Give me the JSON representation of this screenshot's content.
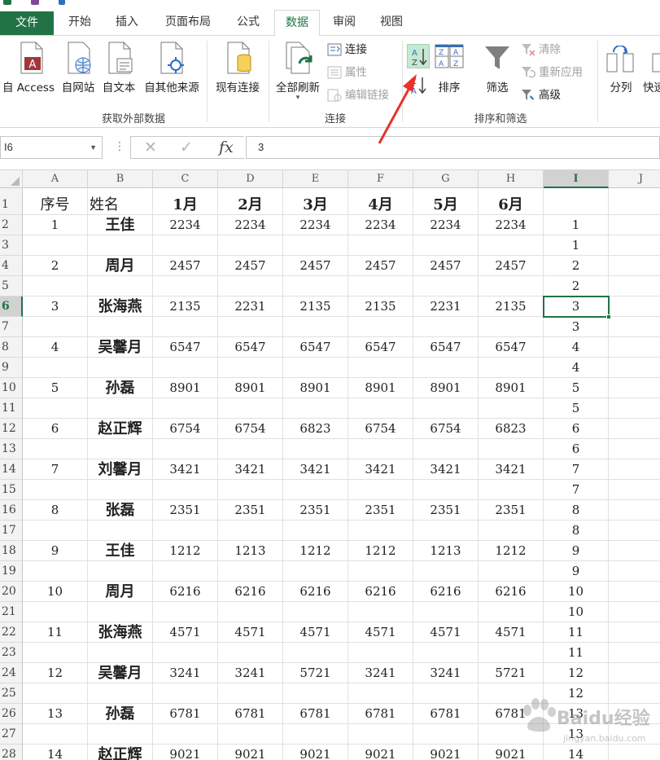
{
  "ribbon_tabs": [
    "文件",
    "开始",
    "插入",
    "页面布局",
    "公式",
    "数据",
    "审阅",
    "视图"
  ],
  "active_tab": "数据",
  "groups": {
    "external": {
      "label": "获取外部数据",
      "buttons": [
        "自 Access",
        "自网站",
        "自文本",
        "自其他来源",
        "现有连接"
      ]
    },
    "connections": {
      "label": "连接",
      "refresh_all": "全部刷新",
      "items": [
        "连接",
        "属性",
        "编辑链接"
      ]
    },
    "sort_filter": {
      "label": "排序和筛选",
      "sort": "排序",
      "filter": "筛选",
      "items": [
        "清除",
        "重新应用",
        "高级"
      ]
    },
    "tools": {
      "split": "分列",
      "quick": "快速"
    }
  },
  "formula_bar": {
    "name_box": "I6",
    "formula": "3",
    "fx": "fx"
  },
  "columns": [
    "A",
    "B",
    "C",
    "D",
    "E",
    "F",
    "G",
    "H",
    "I",
    "J"
  ],
  "selected_column": "I",
  "selected_row": 6,
  "rows": [
    {
      "n": 1,
      "A": "序号",
      "B": "姓名",
      "C": "1月",
      "D": "2月",
      "E": "3月",
      "F": "4月",
      "G": "5月",
      "H": "6月",
      "I": ""
    },
    {
      "n": 2,
      "A": "1",
      "B": "王佳",
      "C": "2234",
      "D": "2234",
      "E": "2234",
      "F": "2234",
      "G": "2234",
      "H": "2234",
      "I": "1"
    },
    {
      "n": 3,
      "A": "",
      "B": "",
      "C": "",
      "D": "",
      "E": "",
      "F": "",
      "G": "",
      "H": "",
      "I": "1"
    },
    {
      "n": 4,
      "A": "2",
      "B": "周月",
      "C": "2457",
      "D": "2457",
      "E": "2457",
      "F": "2457",
      "G": "2457",
      "H": "2457",
      "I": "2"
    },
    {
      "n": 5,
      "A": "",
      "B": "",
      "C": "",
      "D": "",
      "E": "",
      "F": "",
      "G": "",
      "H": "",
      "I": "2"
    },
    {
      "n": 6,
      "A": "3",
      "B": "张海燕",
      "C": "2135",
      "D": "2231",
      "E": "2135",
      "F": "2135",
      "G": "2231",
      "H": "2135",
      "I": "3"
    },
    {
      "n": 7,
      "A": "",
      "B": "",
      "C": "",
      "D": "",
      "E": "",
      "F": "",
      "G": "",
      "H": "",
      "I": "3"
    },
    {
      "n": 8,
      "A": "4",
      "B": "吴馨月",
      "C": "6547",
      "D": "6547",
      "E": "6547",
      "F": "6547",
      "G": "6547",
      "H": "6547",
      "I": "4"
    },
    {
      "n": 9,
      "A": "",
      "B": "",
      "C": "",
      "D": "",
      "E": "",
      "F": "",
      "G": "",
      "H": "",
      "I": "4"
    },
    {
      "n": 10,
      "A": "5",
      "B": "孙磊",
      "C": "8901",
      "D": "8901",
      "E": "8901",
      "F": "8901",
      "G": "8901",
      "H": "8901",
      "I": "5"
    },
    {
      "n": 11,
      "A": "",
      "B": "",
      "C": "",
      "D": "",
      "E": "",
      "F": "",
      "G": "",
      "H": "",
      "I": "5"
    },
    {
      "n": 12,
      "A": "6",
      "B": "赵正辉",
      "C": "6754",
      "D": "6754",
      "E": "6823",
      "F": "6754",
      "G": "6754",
      "H": "6823",
      "I": "6"
    },
    {
      "n": 13,
      "A": "",
      "B": "",
      "C": "",
      "D": "",
      "E": "",
      "F": "",
      "G": "",
      "H": "",
      "I": "6"
    },
    {
      "n": 14,
      "A": "7",
      "B": "刘馨月",
      "C": "3421",
      "D": "3421",
      "E": "3421",
      "F": "3421",
      "G": "3421",
      "H": "3421",
      "I": "7"
    },
    {
      "n": 15,
      "A": "",
      "B": "",
      "C": "",
      "D": "",
      "E": "",
      "F": "",
      "G": "",
      "H": "",
      "I": "7"
    },
    {
      "n": 16,
      "A": "8",
      "B": "张磊",
      "C": "2351",
      "D": "2351",
      "E": "2351",
      "F": "2351",
      "G": "2351",
      "H": "2351",
      "I": "8"
    },
    {
      "n": 17,
      "A": "",
      "B": "",
      "C": "",
      "D": "",
      "E": "",
      "F": "",
      "G": "",
      "H": "",
      "I": "8"
    },
    {
      "n": 18,
      "A": "9",
      "B": "王佳",
      "C": "1212",
      "D": "1213",
      "E": "1212",
      "F": "1212",
      "G": "1213",
      "H": "1212",
      "I": "9"
    },
    {
      "n": 19,
      "A": "",
      "B": "",
      "C": "",
      "D": "",
      "E": "",
      "F": "",
      "G": "",
      "H": "",
      "I": "9"
    },
    {
      "n": 20,
      "A": "10",
      "B": "周月",
      "C": "6216",
      "D": "6216",
      "E": "6216",
      "F": "6216",
      "G": "6216",
      "H": "6216",
      "I": "10"
    },
    {
      "n": 21,
      "A": "",
      "B": "",
      "C": "",
      "D": "",
      "E": "",
      "F": "",
      "G": "",
      "H": "",
      "I": "10"
    },
    {
      "n": 22,
      "A": "11",
      "B": "张海燕",
      "C": "4571",
      "D": "4571",
      "E": "4571",
      "F": "4571",
      "G": "4571",
      "H": "4571",
      "I": "11"
    },
    {
      "n": 23,
      "A": "",
      "B": "",
      "C": "",
      "D": "",
      "E": "",
      "F": "",
      "G": "",
      "H": "",
      "I": "11"
    },
    {
      "n": 24,
      "A": "12",
      "B": "吴馨月",
      "C": "3241",
      "D": "3241",
      "E": "5721",
      "F": "3241",
      "G": "3241",
      "H": "5721",
      "I": "12"
    },
    {
      "n": 25,
      "A": "",
      "B": "",
      "C": "",
      "D": "",
      "E": "",
      "F": "",
      "G": "",
      "H": "",
      "I": "12"
    },
    {
      "n": 26,
      "A": "13",
      "B": "孙磊",
      "C": "6781",
      "D": "6781",
      "E": "6781",
      "F": "6781",
      "G": "6781",
      "H": "6781",
      "I": "13"
    },
    {
      "n": 27,
      "A": "",
      "B": "",
      "C": "",
      "D": "",
      "E": "",
      "F": "",
      "G": "",
      "H": "",
      "I": "13"
    },
    {
      "n": 28,
      "A": "14",
      "B": "赵正辉",
      "C": "9021",
      "D": "9021",
      "E": "9021",
      "F": "9021",
      "G": "9021",
      "H": "9021",
      "I": "14"
    }
  ],
  "watermark": {
    "brand": "Baidu经验",
    "url": "jingyan.baidu.com"
  },
  "colors": {
    "accent": "#217346",
    "annotation": "#e8322c"
  }
}
